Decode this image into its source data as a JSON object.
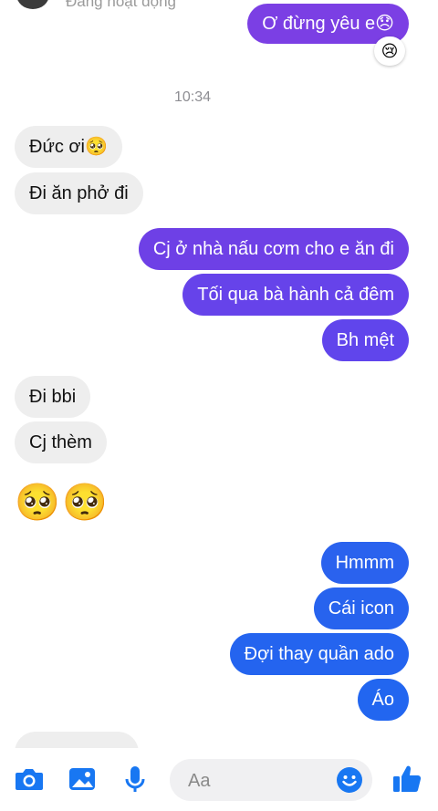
{
  "header": {
    "status": "Đang hoạt động"
  },
  "colors": {
    "out_top": "#7b3fe4",
    "out_mid": "#5b46ee",
    "out_bottom": "#2563ee",
    "in_bg": "#eeeeee",
    "accent": "#1877f2"
  },
  "messages": {
    "m0": "Ơ đừng yêu e😞",
    "react0": "😢",
    "timestamp": "10:34",
    "m1": "Đức ơi🥺",
    "m2": "Đi ăn phở đi",
    "m3": "Cj ở nhà nấu cơm cho e ăn đi",
    "m4": "Tối qua bà hành cả đêm",
    "m5": "Bh mệt",
    "m6": "Đi bbi",
    "m7": "Cj thèm",
    "m8": "🥺",
    "m9": "🥺",
    "m10": "Hmmm",
    "m11": "Cái icon",
    "m12": "Đợi thay quần ado",
    "m13": "Áo"
  },
  "composer": {
    "placeholder": "Aa"
  },
  "icons": {
    "camera": "camera-icon",
    "gallery": "photo-gallery-icon",
    "mic": "microphone-icon",
    "emoji": "emoji-icon",
    "like": "thumbs-up-icon"
  }
}
